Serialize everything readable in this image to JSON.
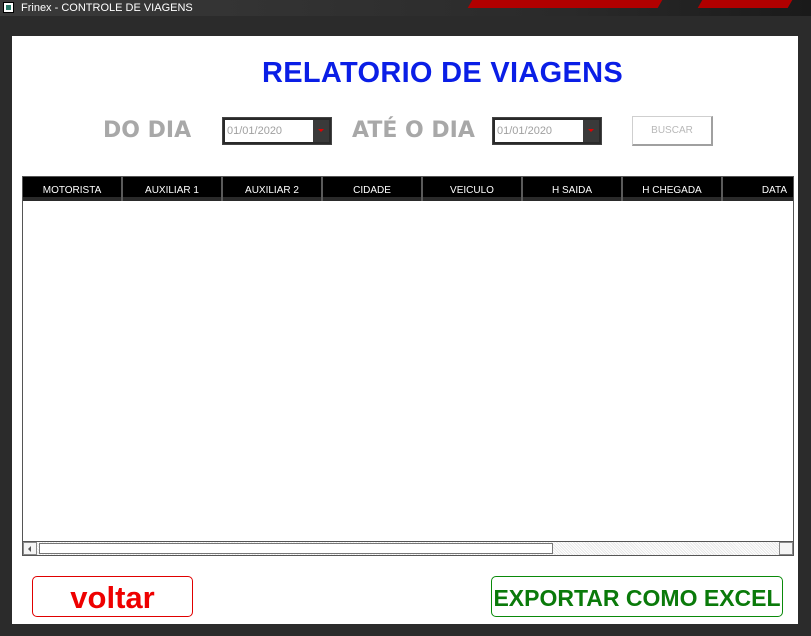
{
  "window": {
    "title": "Frinex - CONTROLE DE VIAGENS"
  },
  "header": {
    "title": "RELATORIO DE VIAGENS"
  },
  "filters": {
    "from_label": "DO DIA",
    "from_value": "01/01/2020",
    "to_label": "ATÉ O DIA",
    "to_value": "01/01/2020",
    "search_label": "BUSCAR"
  },
  "table": {
    "columns": [
      "MOTORISTA",
      "AUXILIAR 1",
      "AUXILIAR 2",
      "CIDADE",
      "VEICULO",
      "H SAIDA",
      "H CHEGADA",
      "DATA"
    ],
    "rows": []
  },
  "footer": {
    "back_label": "voltar",
    "export_label": "EXPORTAR COMO EXCEL"
  },
  "colors": {
    "title": "#0a1ee6",
    "back": "#ee0000",
    "export": "#0a7a0a",
    "label": "#a8a8a8"
  }
}
